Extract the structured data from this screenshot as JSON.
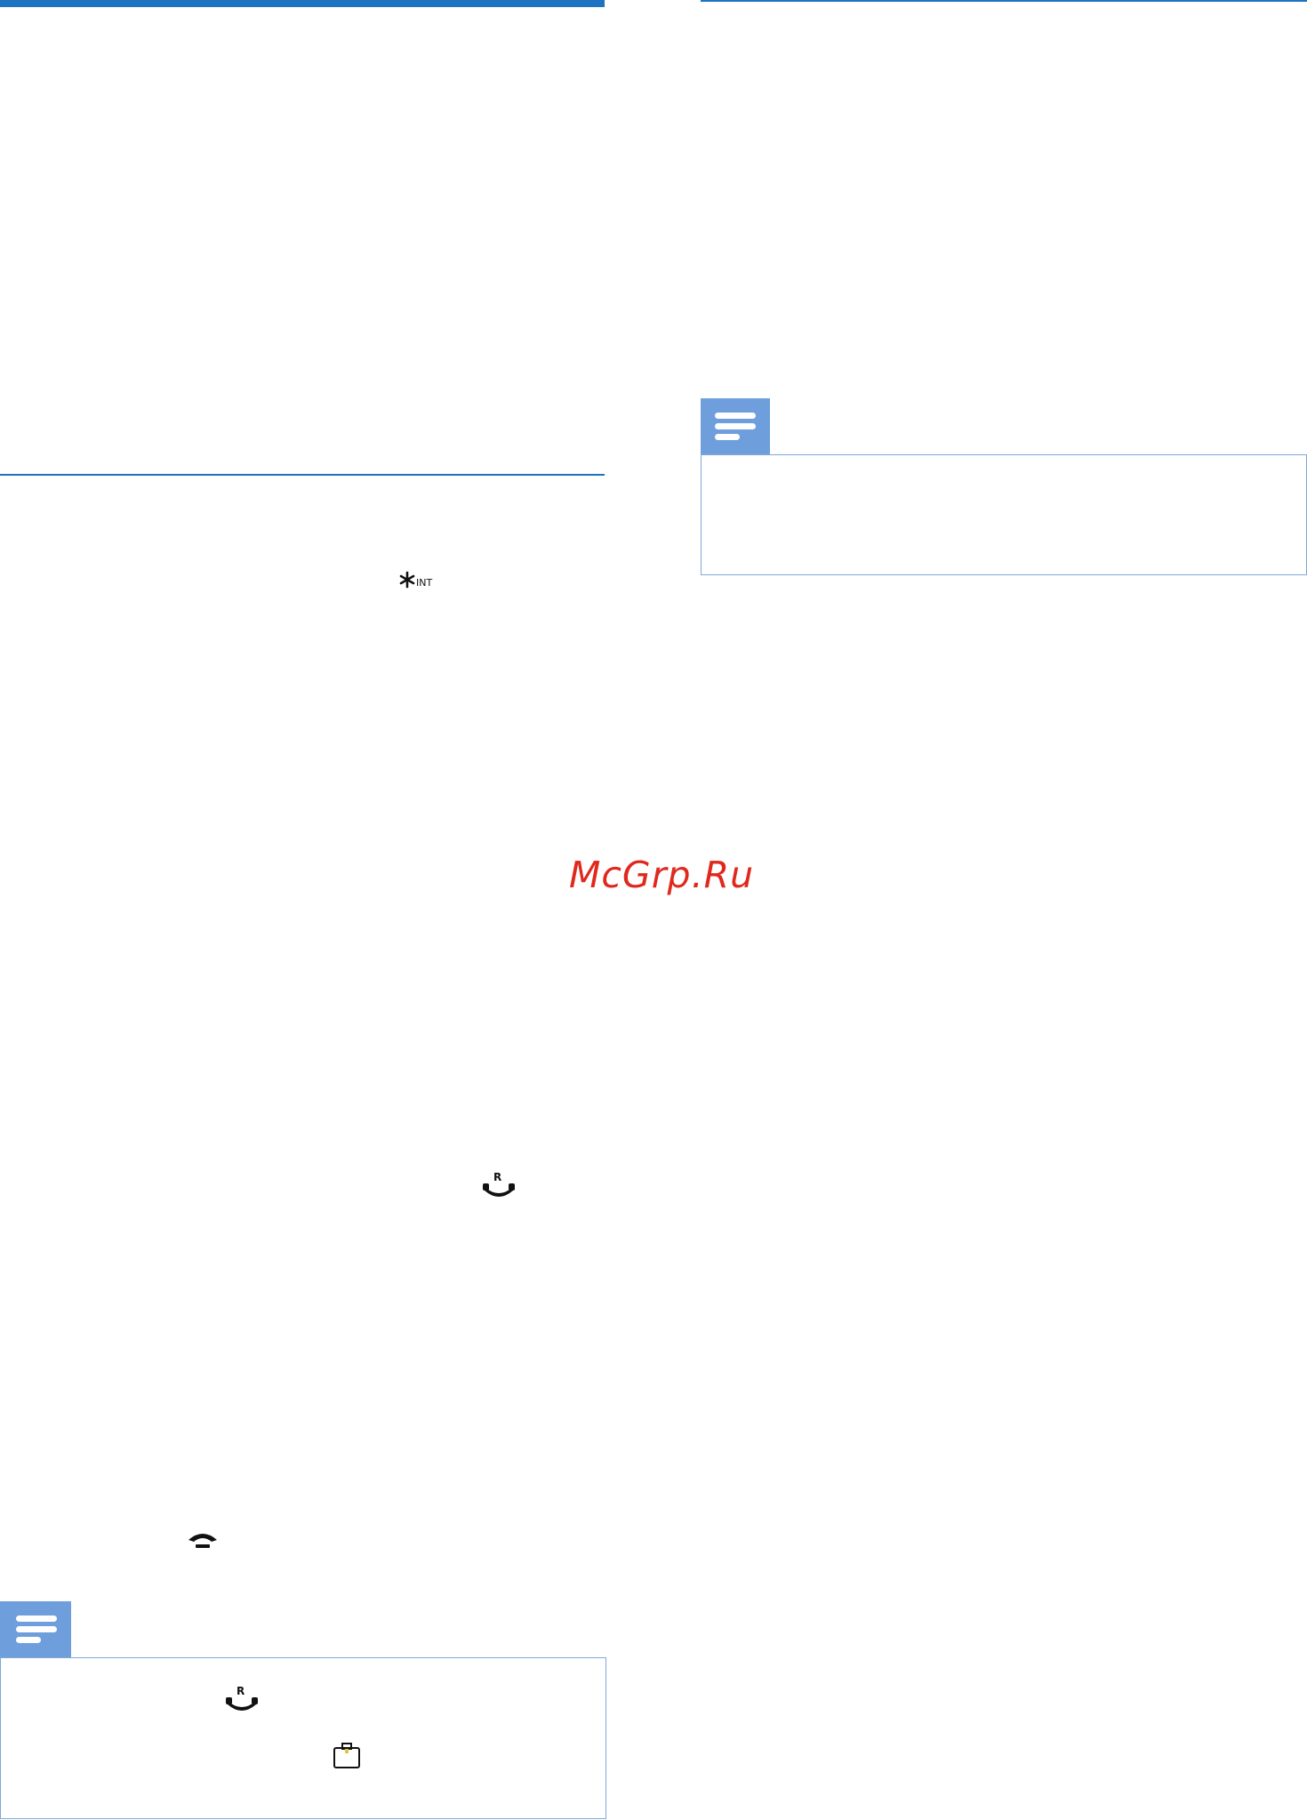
{
  "watermark": {
    "text": "McGrp.Ru"
  },
  "icons": {
    "intercom_key": {
      "name": "star-int-key-icon",
      "label": "INT"
    },
    "recall_key": {
      "name": "recall-talk-key-icon",
      "label": "R"
    },
    "end_call_key": {
      "name": "end-call-key-icon"
    },
    "recall_key_note": {
      "name": "recall-talk-key-icon",
      "label": "R"
    },
    "menu_key_note": {
      "name": "menu-key-icon"
    },
    "note_left": {
      "name": "note-icon"
    },
    "note_right": {
      "name": "note-icon"
    }
  },
  "colors": {
    "accent": "#1d72c2",
    "note_tab": "#6e9fdc",
    "note_border": "#7fa8d8",
    "watermark": "#e0281d"
  }
}
